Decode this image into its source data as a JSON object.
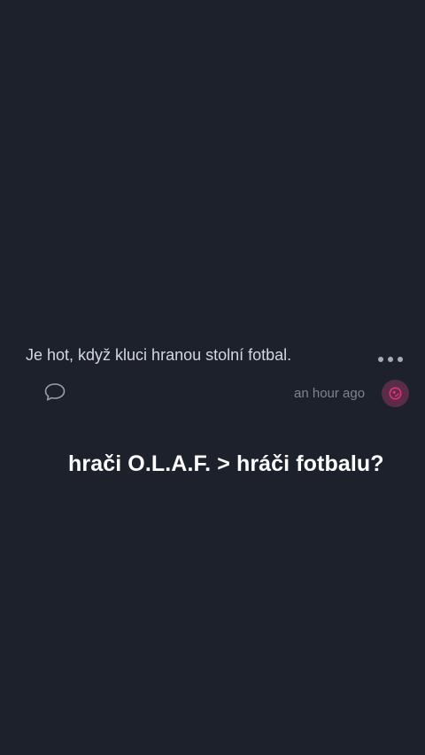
{
  "post": {
    "text": "Je hot, když kluci hranou stolní fotbal.",
    "timestamp": "an hour ago",
    "more_icon": "more-horizontal-icon",
    "comment_icon": "comment-bubble-icon",
    "avatar_icon": "user-avatar-icon"
  },
  "overlay": {
    "caption": "hrači O.L.A.F. > hráči fotbalu?"
  },
  "colors": {
    "background": "#1c212b",
    "post_text": "#d4d7dc",
    "timestamp": "#7f848d",
    "avatar_bg": "#5a2c45",
    "avatar_fg": "#e0337f",
    "caption": "#ffffff"
  }
}
